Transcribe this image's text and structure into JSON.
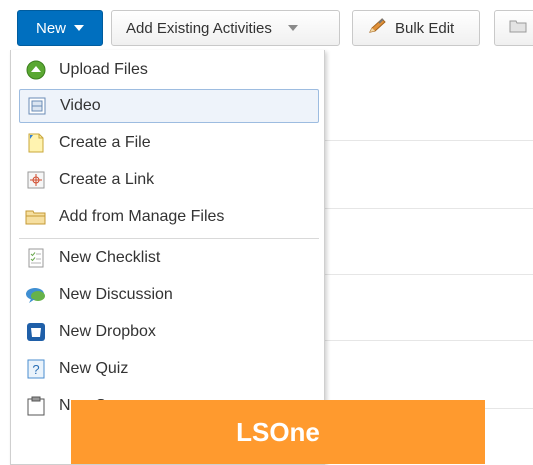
{
  "toolbar": {
    "new_label": "New",
    "add_existing_label": "Add Existing Activities",
    "bulk_edit_label": "Bulk Edit"
  },
  "menu": {
    "items": [
      {
        "label": "Upload Files",
        "icon": "upload-icon"
      },
      {
        "label": "Video",
        "icon": "video-icon",
        "selected": true
      },
      {
        "label": "Create a File",
        "icon": "file-icon"
      },
      {
        "label": "Create a Link",
        "icon": "link-icon"
      },
      {
        "label": "Add from Manage Files",
        "icon": "folder-icon"
      },
      {
        "label": "New Checklist",
        "icon": "checklist-icon"
      },
      {
        "label": "New Discussion",
        "icon": "discussion-icon"
      },
      {
        "label": "New Dropbox",
        "icon": "dropbox-icon"
      },
      {
        "label": "New Quiz",
        "icon": "quiz-icon"
      },
      {
        "label": "New S",
        "icon": "survey-icon"
      }
    ]
  },
  "banner": {
    "label": "LSOne"
  },
  "colors": {
    "primary_button": "#006fbf",
    "banner": "#ff9a2e",
    "selected_bg": "#eef3fa"
  }
}
